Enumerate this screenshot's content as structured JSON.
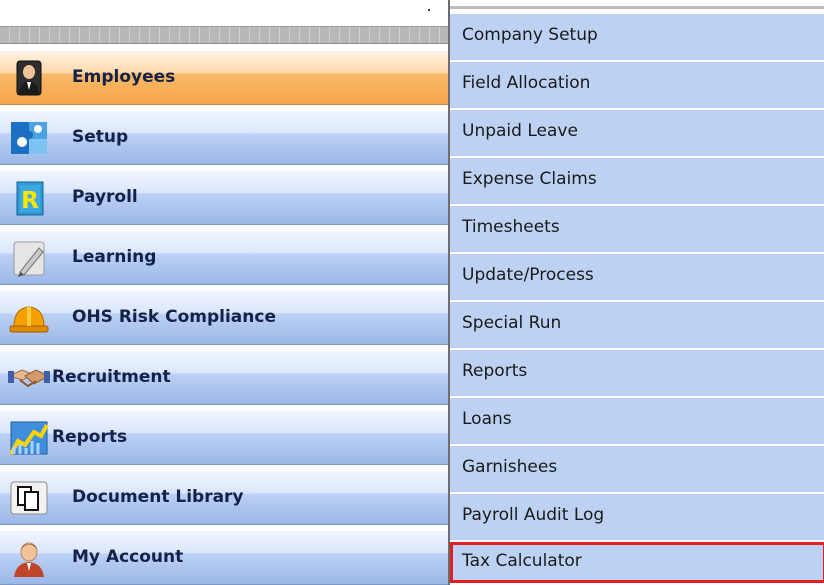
{
  "nav": {
    "items": [
      {
        "label": "Employees",
        "icon": "employee-avatar-icon"
      },
      {
        "label": "Setup",
        "icon": "puzzle-icon"
      },
      {
        "label": "Payroll",
        "icon": "rand-r-icon"
      },
      {
        "label": "Learning",
        "icon": "pencil-icon"
      },
      {
        "label": "OHS Risk Compliance",
        "icon": "hard-hat-icon"
      },
      {
        "label": "Recruitment",
        "icon": "handshake-icon"
      },
      {
        "label": "Reports",
        "icon": "chart-icon"
      },
      {
        "label": "Document Library",
        "icon": "documents-icon"
      },
      {
        "label": "My Account",
        "icon": "user-account-icon"
      }
    ],
    "active_label": "Employees"
  },
  "submenu": {
    "items": [
      {
        "label": "Company Setup"
      },
      {
        "label": "Field Allocation"
      },
      {
        "label": "Unpaid Leave"
      },
      {
        "label": "Expense Claims"
      },
      {
        "label": "Timesheets"
      },
      {
        "label": "Update/Process"
      },
      {
        "label": "Special Run"
      },
      {
        "label": "Reports"
      },
      {
        "label": "Loans"
      },
      {
        "label": "Garnishees"
      },
      {
        "label": "Payroll Audit Log"
      },
      {
        "label": "Tax Calculator"
      }
    ],
    "highlighted_label": "Tax Calculator"
  },
  "colors": {
    "active_nav": "#f5a449",
    "nav_blue": "#bcd1f4",
    "submenu_bg": "#bdd2f3",
    "highlight_border": "#e02020"
  }
}
